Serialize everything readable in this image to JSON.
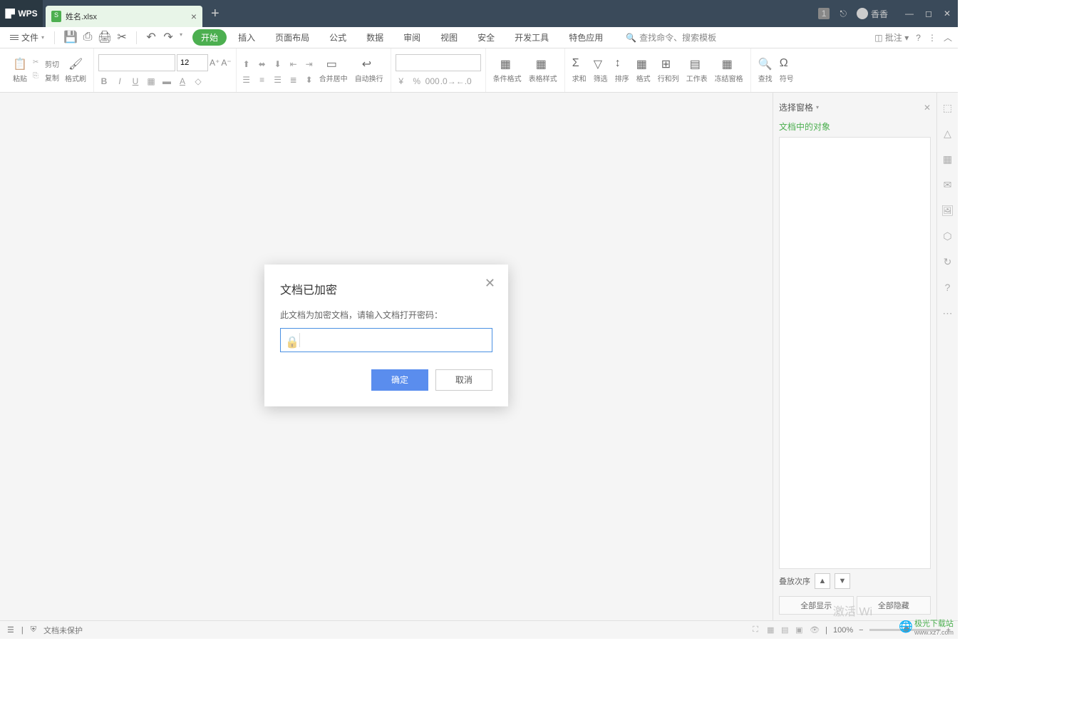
{
  "titlebar": {
    "app": "WPS",
    "docName": "姓名.xlsx",
    "badge": "1",
    "user": "香香"
  },
  "menu": {
    "file": "文件",
    "tabs": [
      "开始",
      "插入",
      "页面布局",
      "公式",
      "数据",
      "审阅",
      "视图",
      "安全",
      "开发工具",
      "特色应用"
    ],
    "search": "查找命令、搜索模板",
    "annotate": "批注"
  },
  "ribbon": {
    "paste": "粘贴",
    "cut": "剪切",
    "copy": "复制",
    "formatPainter": "格式刷",
    "fontSize": "12",
    "mergeCenter": "合并居中",
    "autoWrap": "自动换行",
    "conditional": "条件格式",
    "tableStyle": "表格样式",
    "sum": "求和",
    "filter": "筛选",
    "sort": "排序",
    "format": "格式",
    "rowsCols": "行和列",
    "worksheet": "工作表",
    "freeze": "冻结窗格",
    "find": "查找",
    "symbol": "符号"
  },
  "sidePanel": {
    "title": "选择窗格",
    "subtitle": "文档中的对象",
    "stackLabel": "叠放次序",
    "showAll": "全部显示",
    "hideAll": "全部隐藏"
  },
  "dialog": {
    "title": "文档已加密",
    "message": "此文档为加密文档，请输入文档打开密码：",
    "ok": "确定",
    "cancel": "取消"
  },
  "statusbar": {
    "protection": "文档未保护",
    "zoom": "100%"
  },
  "watermark": "激活 Wi",
  "brand": {
    "name": "极光下载站",
    "url": "www.xz7.com"
  }
}
